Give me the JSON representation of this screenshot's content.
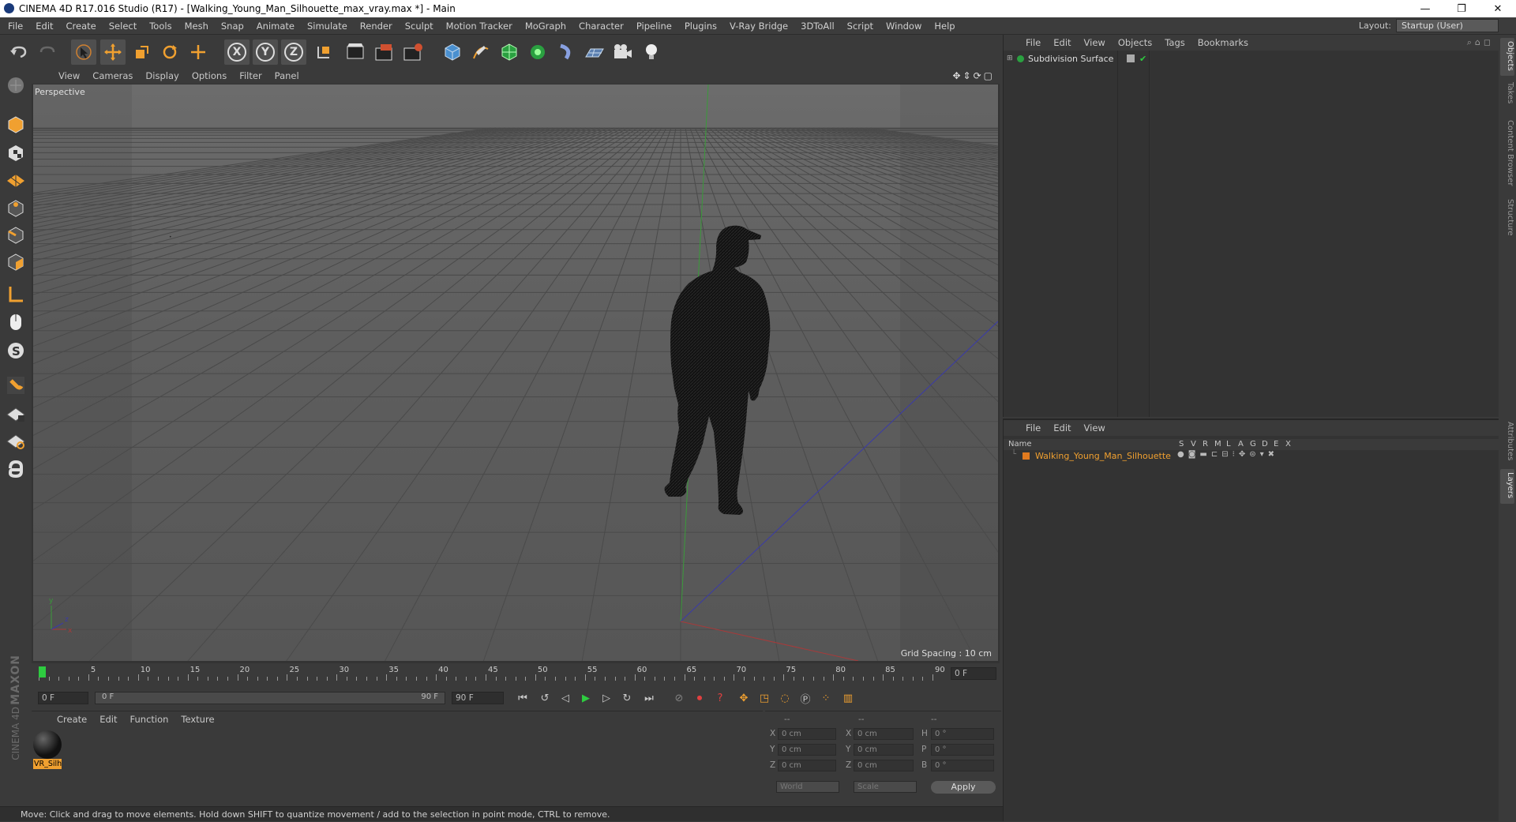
{
  "window": {
    "title": "CINEMA 4D R17.016 Studio (R17) - [Walking_Young_Man_Silhouette_max_vray.max *] - Main",
    "controls": [
      "—",
      "❐",
      "✕"
    ]
  },
  "menubar": {
    "items": [
      "File",
      "Edit",
      "Create",
      "Select",
      "Tools",
      "Mesh",
      "Snap",
      "Animate",
      "Simulate",
      "Render",
      "Sculpt",
      "Motion Tracker",
      "MoGraph",
      "Character",
      "Pipeline",
      "Plugins",
      "V-Ray Bridge",
      "3DToAll",
      "Script",
      "Window",
      "Help"
    ],
    "layout_label": "Layout:",
    "layout_value": "Startup (User)"
  },
  "toolbar": {
    "axis_x": "X",
    "axis_y": "Y",
    "axis_z": "Z"
  },
  "viewport": {
    "menu": [
      "View",
      "Cameras",
      "Display",
      "Options",
      "Filter",
      "Panel"
    ],
    "camera_label": "Perspective",
    "grid_spacing": "Grid Spacing : 10 cm",
    "axis_y": "y",
    "axis_x": "x",
    "axis_z": "z"
  },
  "timeline": {
    "ticks": [
      "0",
      "5",
      "10",
      "15",
      "20",
      "25",
      "30",
      "35",
      "40",
      "45",
      "50",
      "55",
      "60",
      "65",
      "70",
      "75",
      "80",
      "85",
      "90"
    ],
    "current_frame": "0 F"
  },
  "transport": {
    "start_field": "0 F",
    "range_start": "0 F",
    "range_end": "90 F",
    "end_field": "90 F"
  },
  "materials": {
    "menu": [
      "Create",
      "Edit",
      "Function",
      "Texture"
    ],
    "items": [
      {
        "name": "VR_Silhc"
      }
    ]
  },
  "brand": {
    "maxon": "MAXON",
    "cinema": "CINEMA 4D"
  },
  "coords": {
    "headers": [
      "--",
      "--",
      "--"
    ],
    "rows": [
      {
        "l1": "X",
        "v1": "0 cm",
        "l2": "X",
        "v2": "0 cm",
        "l3": "H",
        "v3": "0 °"
      },
      {
        "l1": "Y",
        "v1": "0 cm",
        "l2": "Y",
        "v2": "0 cm",
        "l3": "P",
        "v3": "0 °"
      },
      {
        "l1": "Z",
        "v1": "0 cm",
        "l2": "Z",
        "v2": "0 cm",
        "l3": "B",
        "v3": "0 °"
      }
    ],
    "mode_world": "World",
    "mode_scale": "Scale",
    "apply": "Apply"
  },
  "status": {
    "text": "Move: Click and drag to move elements. Hold down SHIFT to quantize movement / add to the selection in point mode, CTRL to remove."
  },
  "object_manager": {
    "menu": [
      "File",
      "Edit",
      "View",
      "Objects",
      "Tags",
      "Bookmarks"
    ],
    "objects": [
      {
        "name": "Subdivision Surface"
      }
    ]
  },
  "layer_manager": {
    "menu": [
      "File",
      "Edit",
      "View"
    ],
    "col_name": "Name",
    "col_flags": [
      "S",
      "V",
      "R",
      "M",
      "L",
      "A",
      "G",
      "D",
      "E",
      "X"
    ],
    "layers": [
      {
        "name": "Walking_Young_Man_Silhouette",
        "color": "#e07a1f"
      }
    ]
  },
  "right_tabs": [
    "Objects",
    "Takes",
    "Content Browser",
    "Structure",
    "Attributes",
    "Layers"
  ],
  "colors": {
    "accent_orange": "#f0a030",
    "selected_green": "#2ecc40",
    "axis_red": "#b03030",
    "axis_green": "#30a030",
    "axis_blue": "#3030b0"
  }
}
